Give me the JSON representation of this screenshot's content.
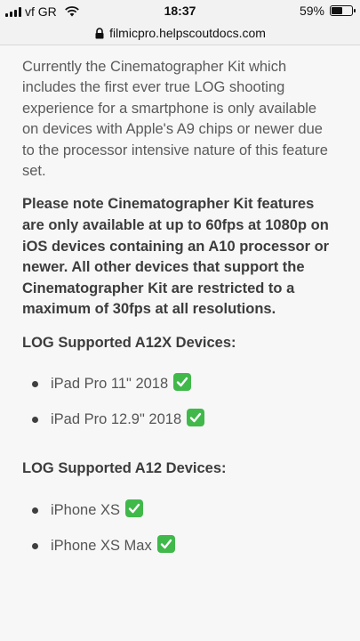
{
  "status_bar": {
    "carrier": "vf GR",
    "time": "18:37",
    "battery_percent": "59%",
    "battery_level": 0.59,
    "signal_bars": 4,
    "icons": [
      "signal-icon",
      "wifi-icon",
      "battery-icon"
    ]
  },
  "browser": {
    "url": "filmicpro.helpscoutdocs.com",
    "secure_icon": "lock-icon"
  },
  "article": {
    "paragraph_1": "Currently the Cinematographer Kit which includes the first ever true LOG shooting experience for a smartphone is only available on devices with Apple's A9 chips or newer due to the processor intensive nature of this feature set.",
    "paragraph_2": "Please note Cinematographer Kit features are only available at up to 60fps at 1080p on iOS devices containing an A10 processor or newer.  All other devices that support the Cinematographer Kit are restricted to a maximum of 30fps at all resolutions.",
    "sections": [
      {
        "heading": "LOG Supported A12X Devices:",
        "items": [
          "iPad Pro 11\" 2018",
          "iPad Pro 12.9\" 2018"
        ]
      },
      {
        "heading": "LOG Supported A12 Devices:",
        "items": [
          "iPhone XS",
          "iPhone XS Max"
        ]
      }
    ],
    "check_icon": "check-mark-icon",
    "check_color": "#40b94a"
  }
}
